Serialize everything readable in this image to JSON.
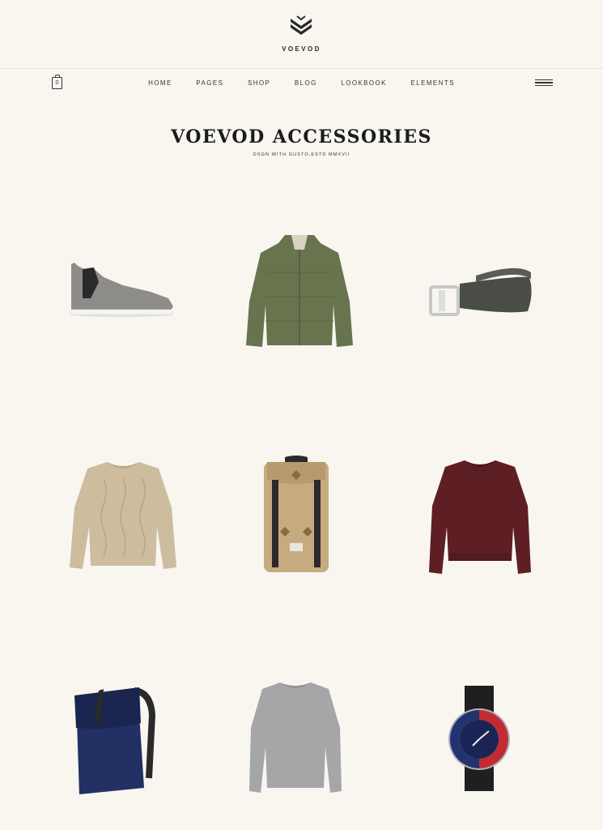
{
  "brand": {
    "name": "VOEVOD"
  },
  "nav": {
    "cart_count": "0",
    "items": [
      "HOME",
      "PAGES",
      "SHOP",
      "BLOG",
      "LOOKBOOK",
      "ELEMENTS"
    ]
  },
  "hero": {
    "title": "VOEVOD ACCESSORIES",
    "subtitle": "DSGN WITH GUSTO,ESTD MMXVII"
  },
  "colors": {
    "background": "#f8f6ef",
    "text": "#222222"
  }
}
